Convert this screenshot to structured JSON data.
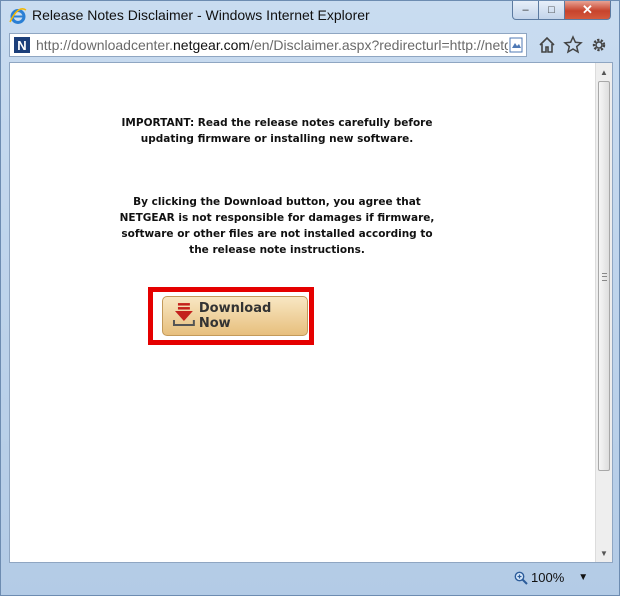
{
  "window": {
    "title": "Release Notes Disclaimer - Windows Internet Explorer",
    "buttons": {
      "minimize": "–",
      "maximize": "□",
      "close": "✕"
    }
  },
  "address_bar": {
    "url_prefix": "http://downloadcenter.",
    "url_domain": "netgear.com",
    "url_suffix": "/en/Disclaimer.aspx?redirecturl=http://netgea",
    "favicon_letter": "N"
  },
  "content": {
    "important_text": "IMPORTANT: Read the release notes carefully before updating firmware or installing new software.",
    "agreement_text": "By clicking the Download button, you agree that NETGEAR is not responsible for damages if firmware, software or other files are not installed according to the release note instructions.",
    "download_button_label": "Download Now"
  },
  "status_bar": {
    "zoom": "100%"
  },
  "colors": {
    "highlight": "#e50000",
    "button_gradient_top": "#f8e7c3",
    "button_gradient_bottom": "#e7bf7d"
  },
  "icons": [
    "ie-logo-icon",
    "netgear-favicon-icon",
    "compatibility-view-icon",
    "home-icon",
    "favorites-star-icon",
    "gear-icon",
    "download-icon",
    "zoom-icon"
  ]
}
